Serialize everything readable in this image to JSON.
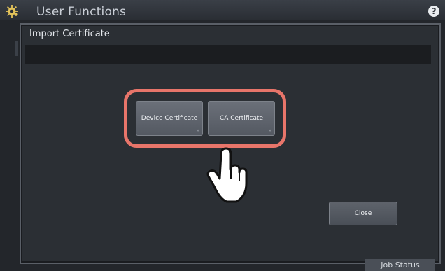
{
  "header": {
    "title": "User Functions",
    "help_label": "?"
  },
  "dialog": {
    "title": "Import Certificate",
    "buttons": {
      "device_certificate": "Device Certificate",
      "ca_certificate": "CA Certificate",
      "close": "Close"
    }
  },
  "footer": {
    "job_status": "Job Status"
  },
  "colors": {
    "highlight": "#e8756a",
    "background": "#23262b",
    "button": "#5f646c"
  },
  "icons": {
    "settings": "gear-icon",
    "help": "help-icon",
    "pointer": "hand-pointer-icon"
  }
}
